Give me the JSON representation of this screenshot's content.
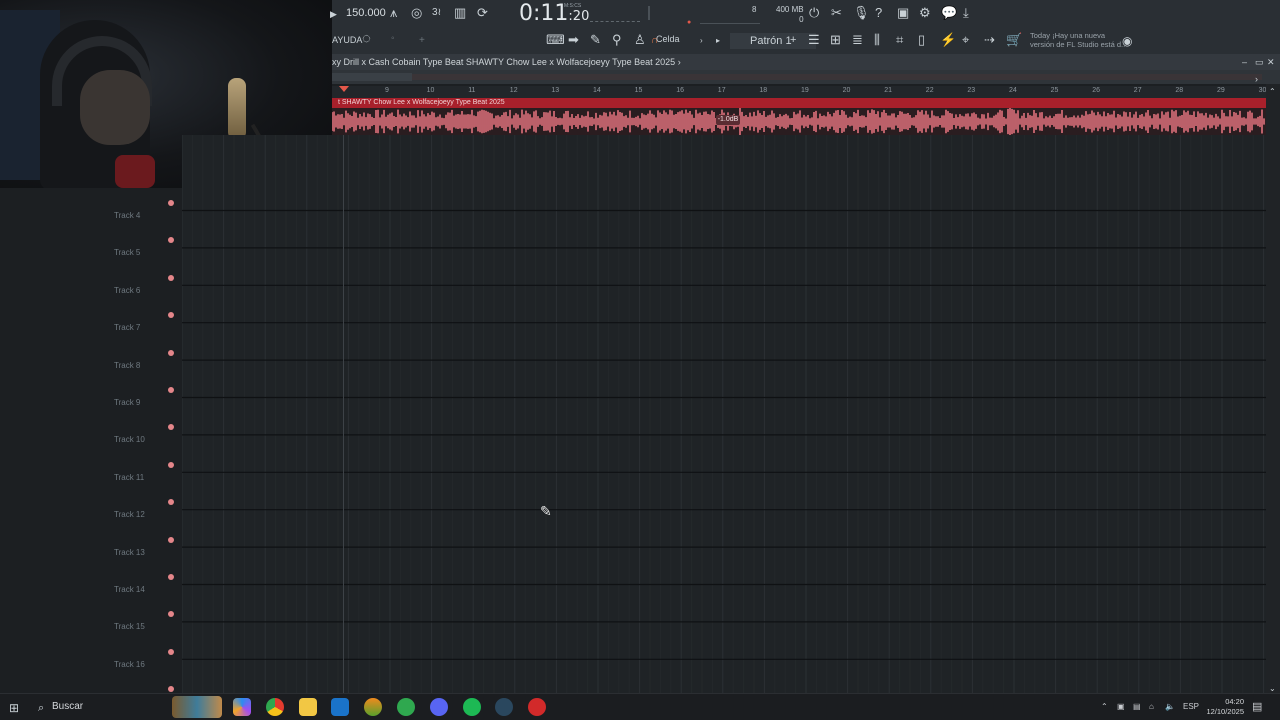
{
  "toolbar": {
    "tempo": "150.000",
    "time_main": "0:11",
    "time_sub": "20",
    "time_label": "M:S:CS",
    "cpu_value": "8",
    "mem_value": "400 MB",
    "mem_sub": "0",
    "help_label": "AYUDA",
    "snap_label": "Celda",
    "pattern_label": "Patrón 1",
    "news_title": "Today",
    "news_text": "¡Hay una nueva versión de FL Studio está d..",
    "accent_color": "#e4584a"
  },
  "playlist": {
    "title": "xy Drill x Cash Cobain Type Beat SHAWTY  Chow Lee x Wolfacejoeyy Type Beat 2025",
    "title_arrow": "›",
    "clip_name": "t SHAWTY  Chow Lee x Wolfacejoeyy Type Beat 2025",
    "clip_gain": "-1.0dB",
    "clip_color": "#a8202b",
    "ruler_numbers": [
      "9",
      "10",
      "11",
      "12",
      "13",
      "14",
      "15",
      "16",
      "17",
      "18",
      "19",
      "20",
      "21",
      "22",
      "23",
      "24",
      "25",
      "26",
      "27",
      "28",
      "29",
      "30"
    ],
    "tracks": [
      "Track 4",
      "Track 5",
      "Track 6",
      "Track 7",
      "Track 8",
      "Track 9",
      "Track 10",
      "Track 11",
      "Track 12",
      "Track 13",
      "Track 14",
      "Track 15",
      "Track 16"
    ]
  },
  "taskbar": {
    "search_placeholder": "Buscar",
    "language": "ESP",
    "time": "04:20",
    "date": "12/10/2025",
    "apps": [
      "widgets-icon",
      "copilot-icon",
      "chrome-icon",
      "file-explorer-icon",
      "outlook-icon",
      "fl-studio-icon",
      "whatsapp-icon",
      "discord-icon",
      "spotify-icon",
      "steam-icon",
      "recorder-icon"
    ]
  }
}
